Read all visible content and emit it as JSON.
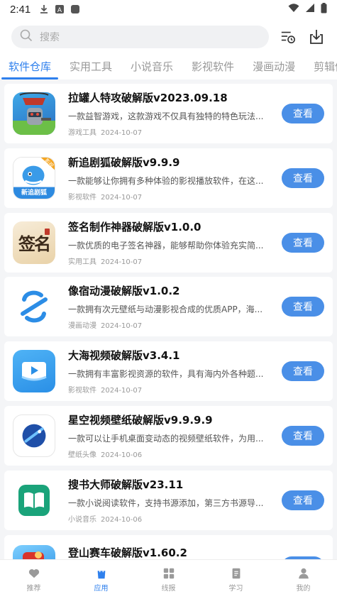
{
  "status": {
    "time": "2:41"
  },
  "search": {
    "placeholder": "搜索"
  },
  "tabs": [
    {
      "label": "软件仓库",
      "active": true
    },
    {
      "label": "实用工具"
    },
    {
      "label": "小说音乐"
    },
    {
      "label": "影视软件"
    },
    {
      "label": "漫画动漫"
    },
    {
      "label": "剪辑修"
    }
  ],
  "apps": [
    {
      "title": "拉罐人特攻破解版v2023.09.18",
      "desc": "一款益智游戏，这款游戏不仅具有独特的特色玩法...",
      "category": "游戏工具",
      "date": "2024-10-07",
      "button": "查看",
      "icon": "can-hero-game-icon"
    },
    {
      "title": "新追剧狐破解版v9.9.9",
      "desc": "一款能够让你拥有多种体验的影视播放软件，在这...",
      "category": "影视软件",
      "date": "2024-10-07",
      "button": "查看",
      "icon": "drama-fox-icon",
      "icon_text": "新追剧狐",
      "icon_badge": "影视"
    },
    {
      "title": "签名制作神器破解版v1.0.0",
      "desc": "一款优质的电子签名神器，能够帮助你体验充实简...",
      "category": "实用工具",
      "date": "2024-10-07",
      "button": "查看",
      "icon": "signature-maker-icon",
      "icon_text": "签名"
    },
    {
      "title": "像宿动漫破解版v1.0.2",
      "desc": "一款拥有次元壁纸与动漫影视合成的优质APP，海...",
      "category": "漫画动漫",
      "date": "2024-10-07",
      "button": "查看",
      "icon": "anime-s-logo-icon"
    },
    {
      "title": "大海视频破解版v3.4.1",
      "desc": "一款拥有丰富影视资源的软件，具有海内外各种题...",
      "category": "影视软件",
      "date": "2024-10-07",
      "button": "查看",
      "icon": "video-play-icon"
    },
    {
      "title": "星空视频壁纸破解版v9.9.9.9",
      "desc": "一款可以让手机桌面变动态的视频壁纸软件，为用...",
      "category": "壁纸头像",
      "date": "2024-10-06",
      "button": "查看",
      "icon": "starry-wallpaper-icon"
    },
    {
      "title": "搜书大师破解版v23.11",
      "desc": "一款小说阅读软件，支持书源添加，第三方书源导...",
      "category": "小说音乐",
      "date": "2024-10-06",
      "button": "查看",
      "icon": "open-book-icon"
    },
    {
      "title": "登山赛车破解版v1.60.2",
      "desc": "",
      "category": "",
      "date": "",
      "button": "查看",
      "icon": "hill-climb-car-icon"
    }
  ],
  "bottom_nav": [
    {
      "label": "推荐",
      "icon": "heart-icon"
    },
    {
      "label": "应用",
      "icon": "bag-icon",
      "active": true
    },
    {
      "label": "线报",
      "icon": "grid-icon"
    },
    {
      "label": "学习",
      "icon": "book-icon"
    },
    {
      "label": "我的",
      "icon": "person-icon"
    }
  ],
  "colors": {
    "accent": "#2f80ed",
    "button": "#4a8fe7"
  }
}
